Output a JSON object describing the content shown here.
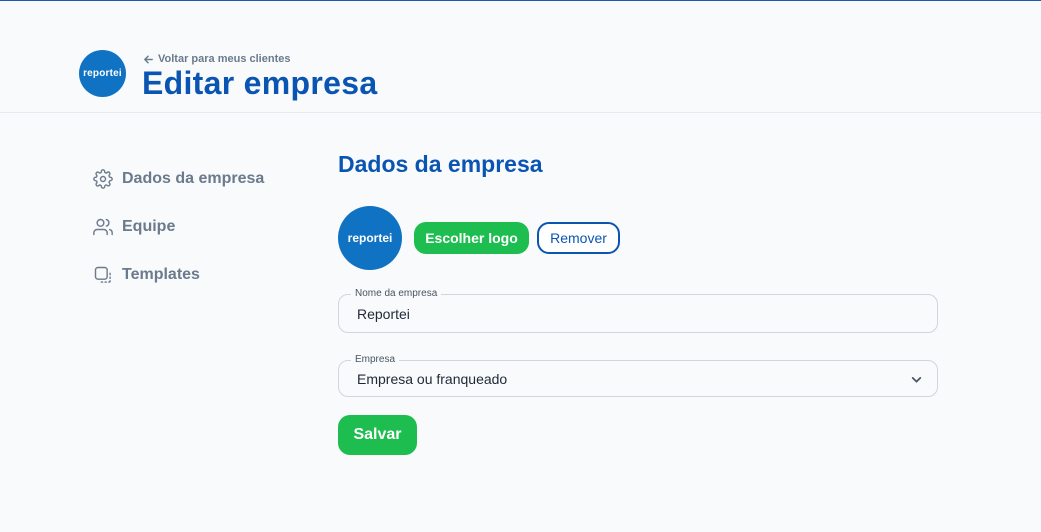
{
  "header": {
    "logo_text": "reportei",
    "back_link": "Voltar para meus clientes",
    "title": "Editar empresa"
  },
  "sidebar": {
    "items": [
      {
        "label": "Dados da empresa",
        "icon": "gear-icon"
      },
      {
        "label": "Equipe",
        "icon": "users-icon"
      },
      {
        "label": "Templates",
        "icon": "template-icon"
      }
    ]
  },
  "main": {
    "section_title": "Dados da empresa",
    "logo_text": "reportei",
    "choose_logo_label": "Escolher logo",
    "remove_label": "Remover",
    "company_name": {
      "label": "Nome da empresa",
      "value": "Reportei"
    },
    "company_type": {
      "label": "Empresa",
      "selected": "Empresa ou franqueado"
    },
    "save_label": "Salvar"
  },
  "colors": {
    "brand_blue": "#0b55b2",
    "logo_blue": "#0f72c3",
    "action_green": "#1dbe4f",
    "muted_text": "#6b7a8c"
  }
}
